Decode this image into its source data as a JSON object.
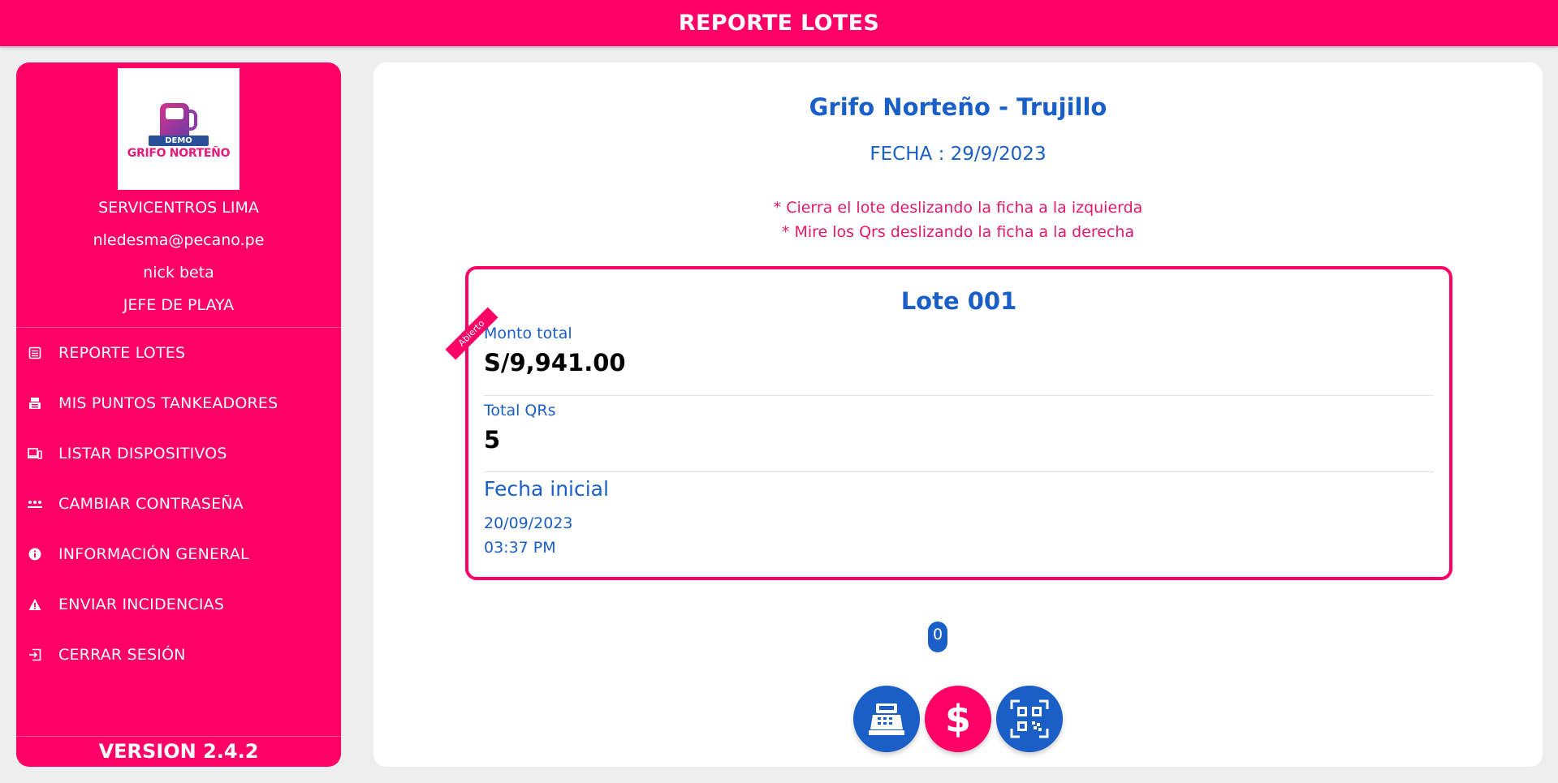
{
  "header": {
    "title": "REPORTE LOTES"
  },
  "sidebar": {
    "logo": {
      "tag": "DEMO",
      "text": "GRIFO NORTEÑO"
    },
    "company": "SERVICENTROS LIMA",
    "email": "nledesma@pecano.pe",
    "username": "nick beta",
    "role": "JEFE DE PLAYA",
    "items": [
      {
        "label": "REPORTE LOTES",
        "icon": "list-icon"
      },
      {
        "label": "MIS PUNTOS TANKEADORES",
        "icon": "cash-register-icon"
      },
      {
        "label": "LISTAR DISPOSITIVOS",
        "icon": "devices-icon"
      },
      {
        "label": "CAMBIAR CONTRASEÑA",
        "icon": "password-icon"
      },
      {
        "label": "INFORMACIÓN GENERAL",
        "icon": "info-icon"
      },
      {
        "label": "ENVIAR INCIDENCIAS",
        "icon": "warning-icon"
      },
      {
        "label": "CERRAR SESIÓN",
        "icon": "logout-icon"
      }
    ],
    "version": "VERSION 2.4.2"
  },
  "main": {
    "station_title": "Grifo Norteño - Trujillo",
    "fecha": "FECHA : 29/9/2023",
    "hints": [
      "* Cierra el lote deslizando la ficha a la izquierda",
      "* Mire los Qrs deslizando la ficha a la derecha"
    ],
    "lote": {
      "status": "Abierto",
      "title": "Lote 001",
      "monto_label": "Monto total",
      "monto_value": "S/9,941.00",
      "qrs_label": "Total QRs",
      "qrs_value": "5",
      "fecha_label": "Fecha inicial",
      "fecha_date": "20/09/2023",
      "fecha_time": "03:37 PM"
    },
    "actions": {
      "badge_count": "0",
      "buttons": [
        "cash-register-icon",
        "dollar-icon",
        "qr-code-icon"
      ]
    }
  },
  "colors": {
    "primary": "#ff0066",
    "accent_blue": "#1a5fc8"
  }
}
